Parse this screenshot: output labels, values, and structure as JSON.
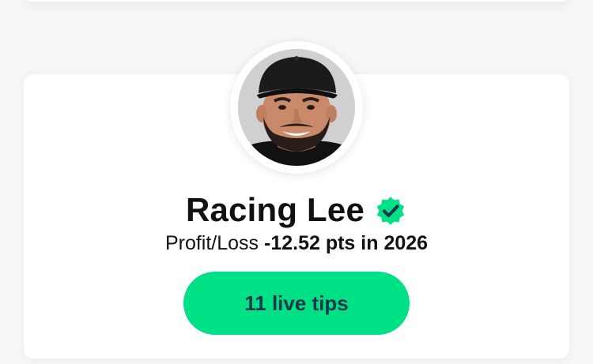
{
  "tipster": {
    "name": "Racing Lee",
    "verified_icon": "verified-badge-icon",
    "profit_loss_label": "Profit/Loss",
    "profit_loss_value": "-12.52 pts in 2026",
    "live_tips_button": "11 live tips"
  },
  "colors": {
    "accent": "#00e086",
    "button_text": "#12364a",
    "text": "#111111",
    "card": "#ffffff",
    "background": "#f7f7f8"
  }
}
